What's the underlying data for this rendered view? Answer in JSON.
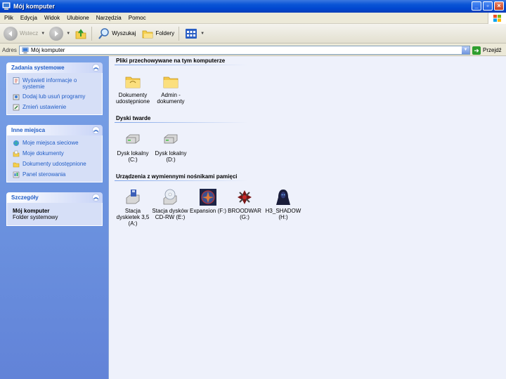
{
  "window": {
    "title": "Mój komputer",
    "buttons": {
      "minimize": "_",
      "maximize": "▫",
      "close": "×"
    }
  },
  "menu": [
    "Plik",
    "Edycja",
    "Widok",
    "Ulubione",
    "Narzędzia",
    "Pomoc"
  ],
  "toolbar": {
    "back_label": "Wstecz",
    "search_label": "Wyszukaj",
    "folders_label": "Foldery"
  },
  "address": {
    "label": "Adres",
    "value": "Mój komputer",
    "go_label": "Przejdź"
  },
  "sidebar": {
    "system_tasks": {
      "title": "Zadania systemowe",
      "items": [
        {
          "label": "Wyświetl informacje o systemie",
          "icon": "system-info-icon"
        },
        {
          "label": "Dodaj lub usuń programy",
          "icon": "add-remove-programs-icon"
        },
        {
          "label": "Zmień ustawienie",
          "icon": "change-setting-icon"
        }
      ]
    },
    "other_places": {
      "title": "Inne miejsca",
      "items": [
        {
          "label": "Moje miejsca sieciowe",
          "icon": "network-places-icon"
        },
        {
          "label": "Moje dokumenty",
          "icon": "my-documents-icon"
        },
        {
          "label": "Dokumenty udostępnione",
          "icon": "shared-documents-icon"
        },
        {
          "label": "Panel sterowania",
          "icon": "control-panel-icon"
        }
      ]
    },
    "details": {
      "title": "Szczegóły",
      "name": "Mój komputer",
      "type": "Folder systemowy"
    }
  },
  "content": {
    "groups": [
      {
        "title": "Pliki przechowywane na tym komputerze",
        "items": [
          {
            "label": "Dokumenty udostępnione",
            "icon": "folder-icon"
          },
          {
            "label": "Admin - dokumenty",
            "icon": "folder-icon"
          }
        ]
      },
      {
        "title": "Dyski twarde",
        "items": [
          {
            "label": "Dysk lokalny (C:)",
            "icon": "hard-disk-icon"
          },
          {
            "label": "Dysk lokalny (D:)",
            "icon": "hard-disk-icon"
          }
        ]
      },
      {
        "title": "Urządzenia z wymiennymi nośnikami pamięci",
        "items": [
          {
            "label": "Stacja dyskietek 3,5 (A:)",
            "icon": "floppy-drive-icon"
          },
          {
            "label": "Stacja dysków CD-RW (E:)",
            "icon": "cd-drive-icon"
          },
          {
            "label": "Expansion (F:)",
            "icon": "expansion-disc-icon"
          },
          {
            "label": "BROODWAR (G:)",
            "icon": "broodwar-disc-icon"
          },
          {
            "label": "H3_SHADOW (H:)",
            "icon": "h3-shadow-disc-icon"
          }
        ]
      }
    ]
  },
  "colors": {
    "title_bar": "#0046cf",
    "sidebar": "#6d95e0",
    "content_bg": "#eef1fb",
    "link": "#215dc6"
  }
}
